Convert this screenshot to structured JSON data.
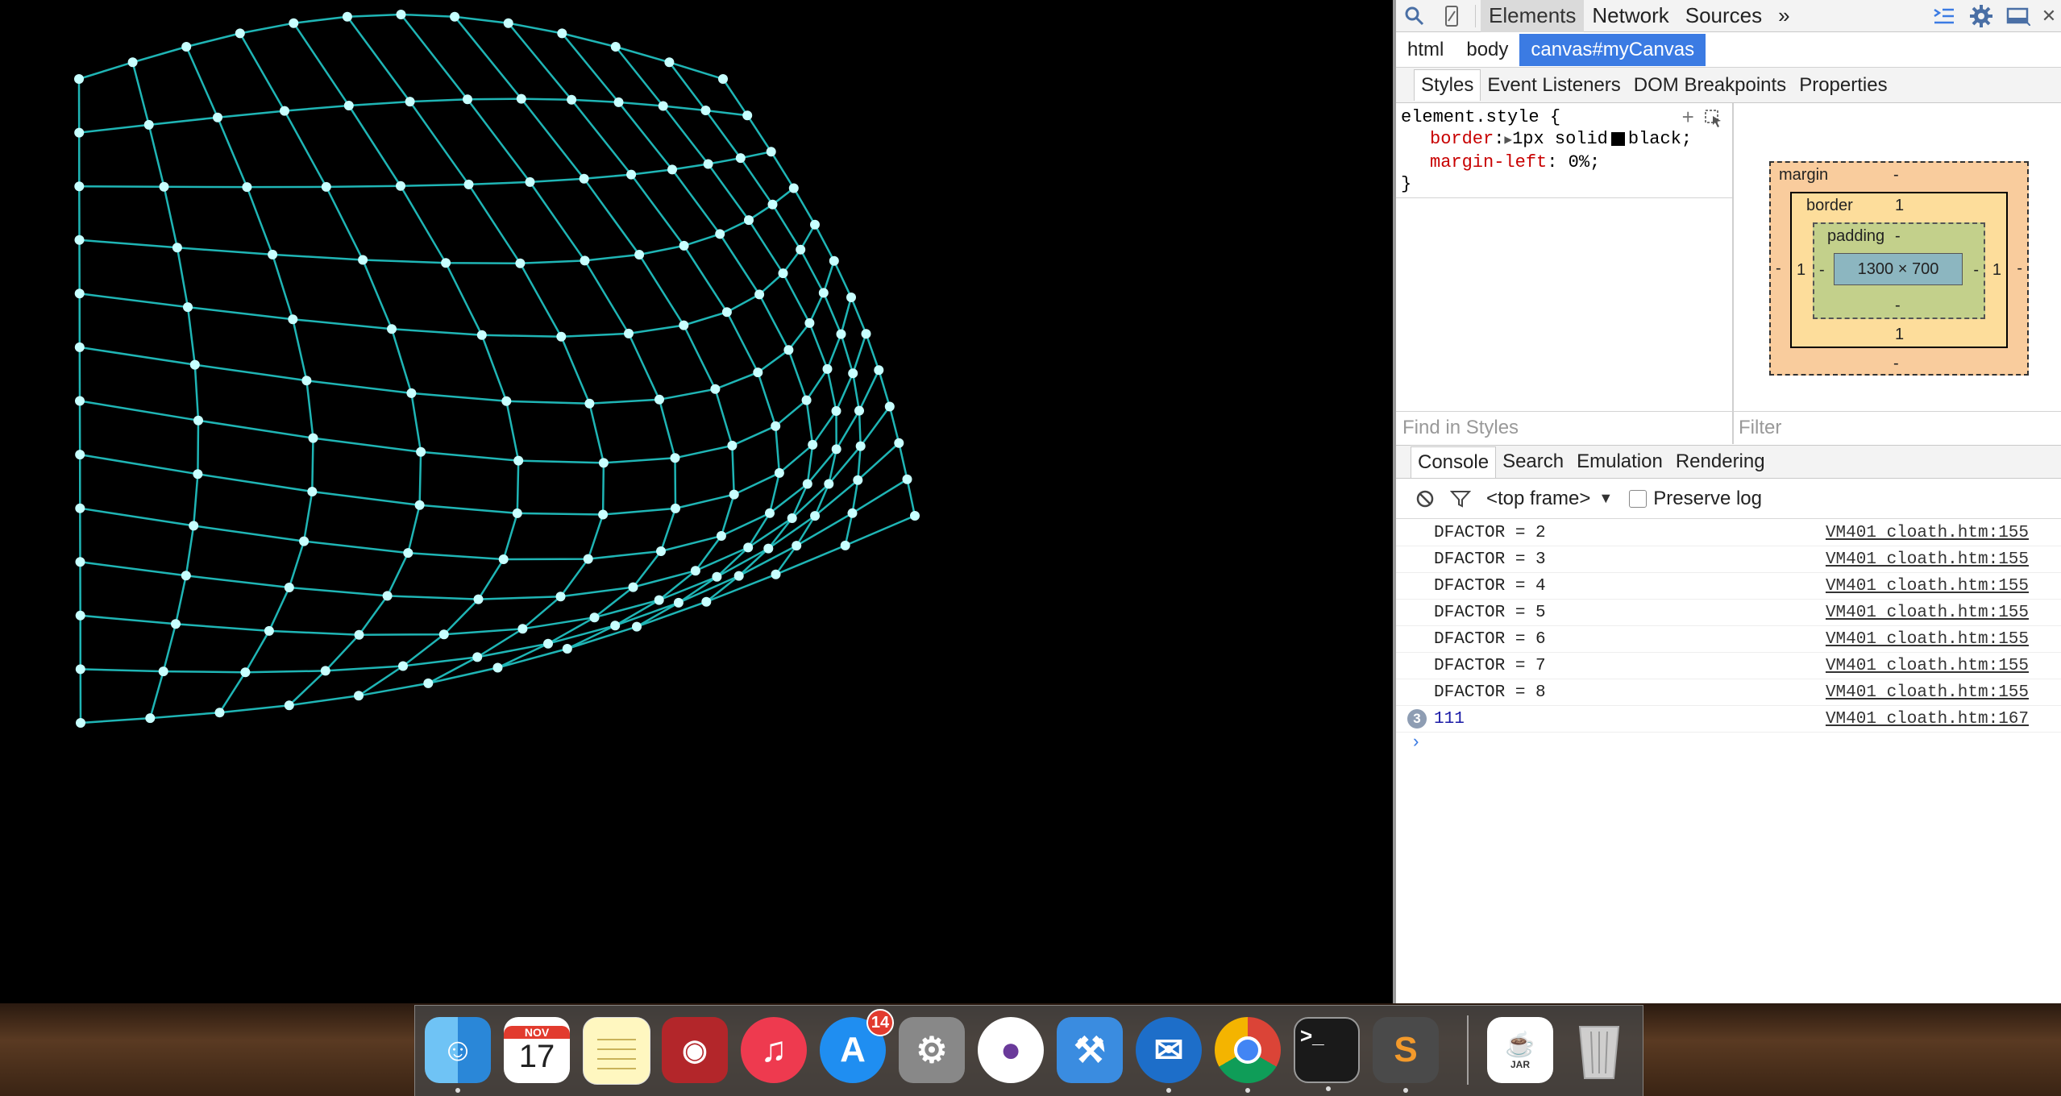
{
  "devtools": {
    "toolbar": {
      "search_icon": "search-icon",
      "device_icon": "device-mode-icon",
      "tabs": [
        "Elements",
        "Network",
        "Sources"
      ],
      "more": "»",
      "drawer_icon": "show-drawer-icon",
      "settings_icon": "gear-icon",
      "dock_icon": "dock-side-icon",
      "close_icon": "close-icon"
    },
    "breadcrumbs": [
      "html",
      "body",
      "canvas#myCanvas"
    ],
    "subtabs": [
      "Styles",
      "Event Listeners",
      "DOM Breakpoints",
      "Properties"
    ],
    "styles": {
      "selector": "element.style {",
      "props": [
        {
          "name": "border",
          "value": "1px solid",
          "color_name": "black;"
        },
        {
          "name": "margin-left",
          "value": "0%;"
        }
      ],
      "close": "}",
      "add_icon": "plus-icon",
      "pick_icon": "element-state-icon",
      "find_placeholder": "Find in Styles",
      "filter_placeholder": "Filter"
    },
    "box_model": {
      "margin_label": "margin",
      "margin_top": "-",
      "margin_bottom": "-",
      "margin_left": "-",
      "margin_right": "-",
      "border_label": "border",
      "border_top": "1",
      "border_bottom": "1",
      "border_left": "1",
      "border_right": "1",
      "padding_label": "padding",
      "padding_top": "-",
      "padding_bottom": "-",
      "padding_left": "-",
      "padding_right": "-",
      "content": "1300 × 700"
    },
    "console_tabs": [
      "Console",
      "Search",
      "Emulation",
      "Rendering"
    ],
    "console_toolbar": {
      "clear_icon": "clear-console-icon",
      "filter_icon": "filter-icon",
      "frame": "<top frame>",
      "preserve_log": "Preserve log"
    },
    "log": [
      {
        "msg": "DFACTOR = 2",
        "src": "VM401 cloath.htm:155"
      },
      {
        "msg": "DFACTOR = 3",
        "src": "VM401 cloath.htm:155"
      },
      {
        "msg": "DFACTOR = 4",
        "src": "VM401 cloath.htm:155"
      },
      {
        "msg": "DFACTOR = 5",
        "src": "VM401 cloath.htm:155"
      },
      {
        "msg": "DFACTOR = 6",
        "src": "VM401 cloath.htm:155"
      },
      {
        "msg": "DFACTOR = 7",
        "src": "VM401 cloath.htm:155"
      },
      {
        "msg": "DFACTOR = 8",
        "src": "VM401 cloath.htm:155"
      },
      {
        "msg": "111",
        "src": "VM401 cloath.htm:167",
        "repeat": "3"
      }
    ],
    "prompt": "›"
  },
  "canvas": {
    "background": "#000000",
    "mesh_color": "#1fb5b5",
    "node_color": "#c8ffff"
  },
  "dock": {
    "items": [
      {
        "name": "finder-icon",
        "running": true
      },
      {
        "name": "calendar-icon",
        "month": "NOV",
        "day": "17",
        "running": false
      },
      {
        "name": "notes-icon",
        "running": false
      },
      {
        "name": "photo-booth-icon",
        "running": false
      },
      {
        "name": "itunes-icon",
        "running": false
      },
      {
        "name": "app-store-icon",
        "badge": "14",
        "running": false
      },
      {
        "name": "system-preferences-icon",
        "running": false
      },
      {
        "name": "github-icon",
        "running": false
      },
      {
        "name": "xcode-icon",
        "running": false
      },
      {
        "name": "thunderbird-icon",
        "running": true
      },
      {
        "name": "chrome-icon",
        "running": true
      },
      {
        "name": "terminal-icon",
        "running": true
      },
      {
        "name": "sublime-text-icon",
        "running": true
      },
      {
        "name": "jar-file-icon",
        "label": "JAR",
        "running": false
      },
      {
        "name": "trash-icon",
        "running": false
      }
    ]
  }
}
